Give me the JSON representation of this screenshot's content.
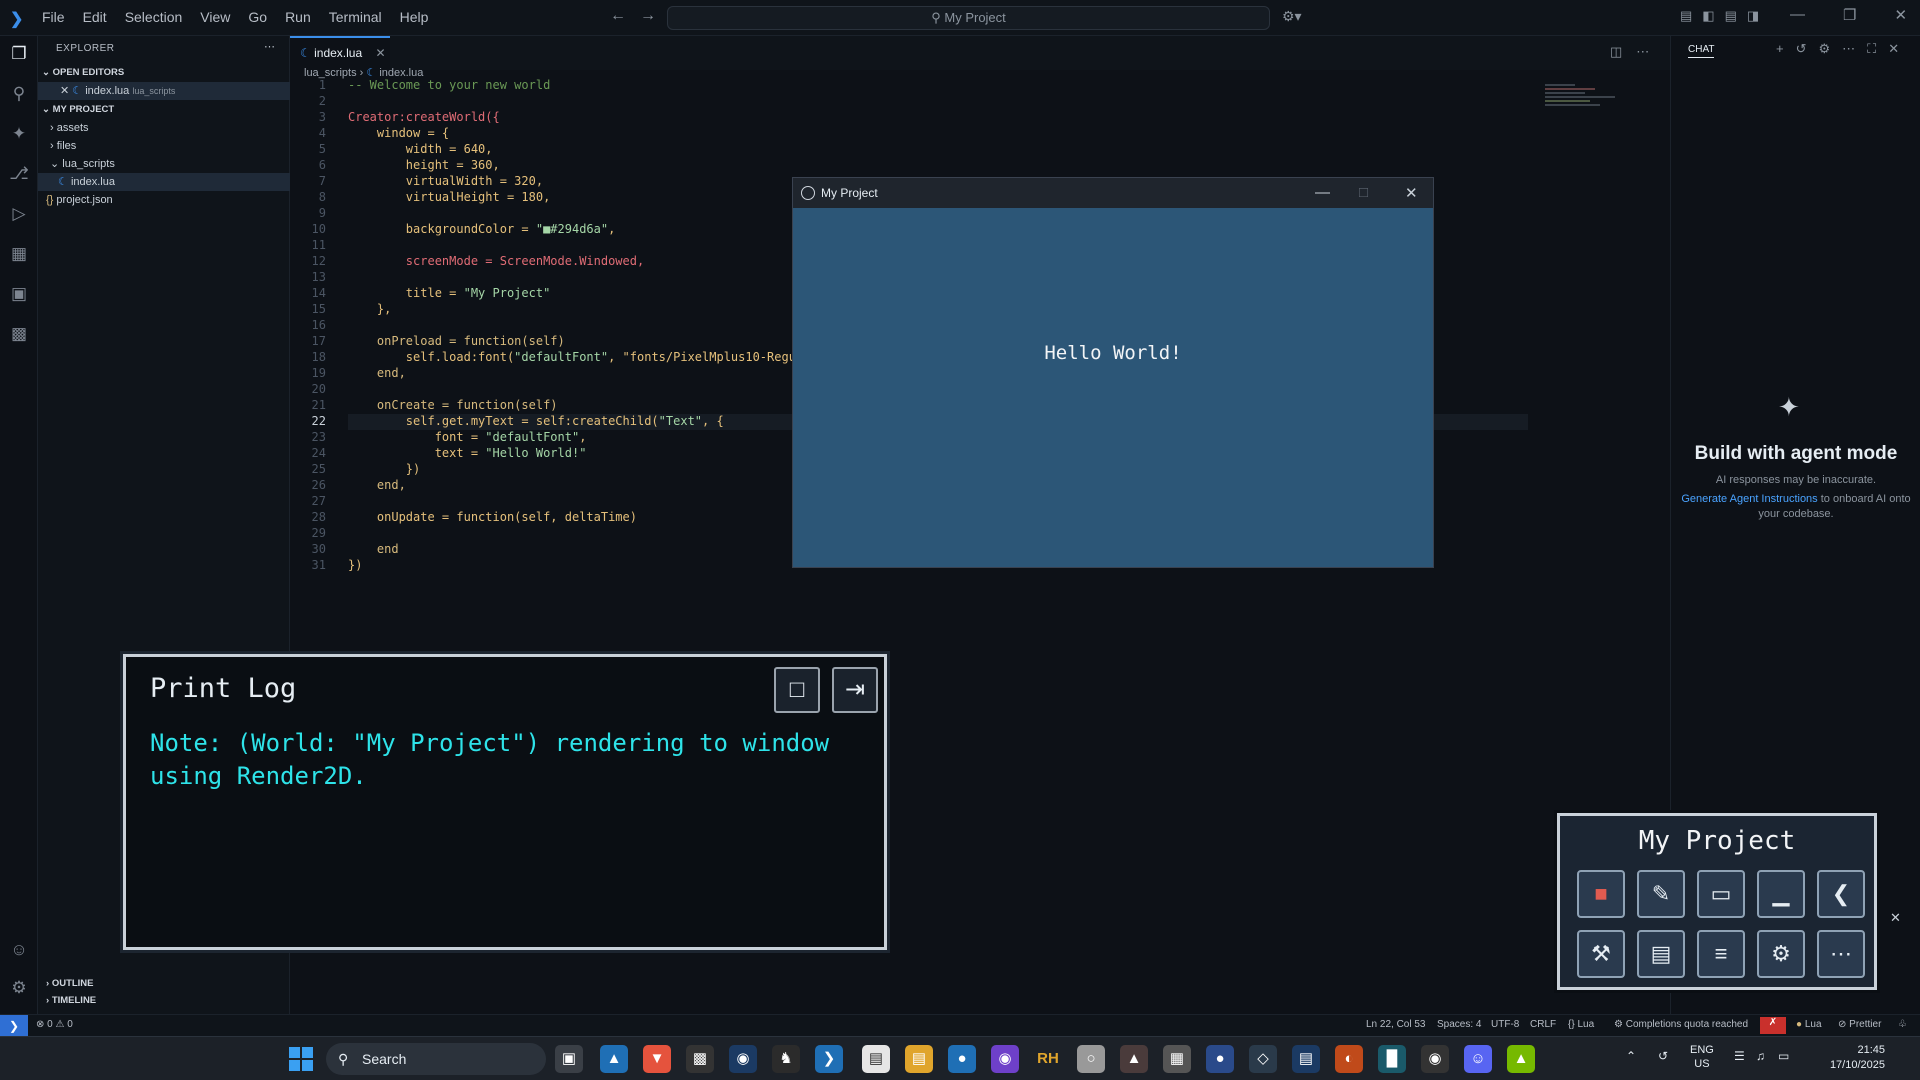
{
  "titlebar": {
    "menu": [
      "File",
      "Edit",
      "Selection",
      "View",
      "Go",
      "Run",
      "Terminal",
      "Help"
    ],
    "search_text": "My Project"
  },
  "sidebar": {
    "header": "EXPLORER",
    "open_editors_label": "OPEN EDITORS",
    "open_editor_file": "index.lua",
    "open_editor_folder": "lua_scripts",
    "project_label": "MY PROJECT",
    "tree": [
      {
        "label": "assets",
        "type": "folder"
      },
      {
        "label": "files",
        "type": "folder"
      },
      {
        "label": "lua_scripts",
        "type": "folder-open"
      },
      {
        "label": "index.lua",
        "type": "file"
      },
      {
        "label": "project.json",
        "type": "json"
      }
    ],
    "outline_label": "OUTLINE",
    "timeline_label": "TIMELINE"
  },
  "editor": {
    "tab_label": "index.lua",
    "breadcrumb_folder": "lua_scripts",
    "breadcrumb_file": "index.lua",
    "current_line": 22,
    "lines": [
      "-- Welcome to your new world",
      "",
      "Creator:createWorld({",
      "    window = {",
      "        width = 640,",
      "        height = 360,",
      "        virtualWidth = 320,",
      "        virtualHeight = 180,",
      "",
      "        backgroundColor = \"■#294d6a\",",
      "",
      "        screenMode = ScreenMode.Windowed,",
      "",
      "        title = \"My Project\"",
      "    },",
      "",
      "    onPreload = function(self)",
      "        self.load:font(\"defaultFont\", \"fonts/PixelMplus10-Regula",
      "    end,",
      "",
      "    onCreate = function(self)",
      "        self.get.myText = self:createChild(\"Text\", {",
      "            font = \"defaultFont\",",
      "            text = \"Hello World!\"",
      "        })",
      "    end,",
      "",
      "    onUpdate = function(self, deltaTime)",
      "",
      "    end",
      "})"
    ]
  },
  "chat": {
    "tab_label": "CHAT",
    "heading": "Build with agent mode",
    "disclaimer": "AI responses may be inaccurate.",
    "link_text": "Generate Agent Instructions",
    "link_suffix": "to onboard AI onto your codebase."
  },
  "game_window": {
    "title": "My Project",
    "content_text": "Hello World!",
    "background_color": "#2c5677"
  },
  "print_log": {
    "title": "Print Log",
    "message": "Note: (World: \"My Project\") rendering to window using Render2D."
  },
  "toolbox": {
    "title": "My Project",
    "buttons": [
      {
        "icon": "stop-icon",
        "glyph": "■"
      },
      {
        "icon": "edit-script-icon",
        "glyph": "✎"
      },
      {
        "icon": "folder-icon",
        "glyph": "▭"
      },
      {
        "icon": "minimize-icon",
        "glyph": "▁"
      },
      {
        "icon": "back-arrow-icon",
        "glyph": "❮"
      },
      {
        "icon": "hammer-icon",
        "glyph": "⚒"
      },
      {
        "icon": "terminal-icon",
        "glyph": "▤"
      },
      {
        "icon": "log-icon",
        "glyph": "≡"
      },
      {
        "icon": "settings-icon",
        "glyph": "⚙"
      },
      {
        "icon": "more-icon",
        "glyph": "⋯"
      }
    ]
  },
  "statusbar": {
    "problems": "⊗ 0 ⚠ 0",
    "cursor": "Ln 22, Col 53",
    "spaces": "Spaces: 4",
    "encoding": "UTF-8",
    "eol": "CRLF",
    "language": "{} Lua",
    "copilot": "Completions quota reached",
    "lua_badge": "Lua",
    "prettier": "Prettier"
  },
  "taskbar": {
    "search_label": "Search",
    "lang_top": "ENG",
    "lang_bottom": "US",
    "time": "21:45",
    "date": "17/10/2025",
    "rh_label": "RH"
  },
  "colors": {
    "accent": "#3b8eea",
    "log_text": "#2ee3e9",
    "keyword": "#d7ba7d",
    "string": "#a5d6a7"
  }
}
